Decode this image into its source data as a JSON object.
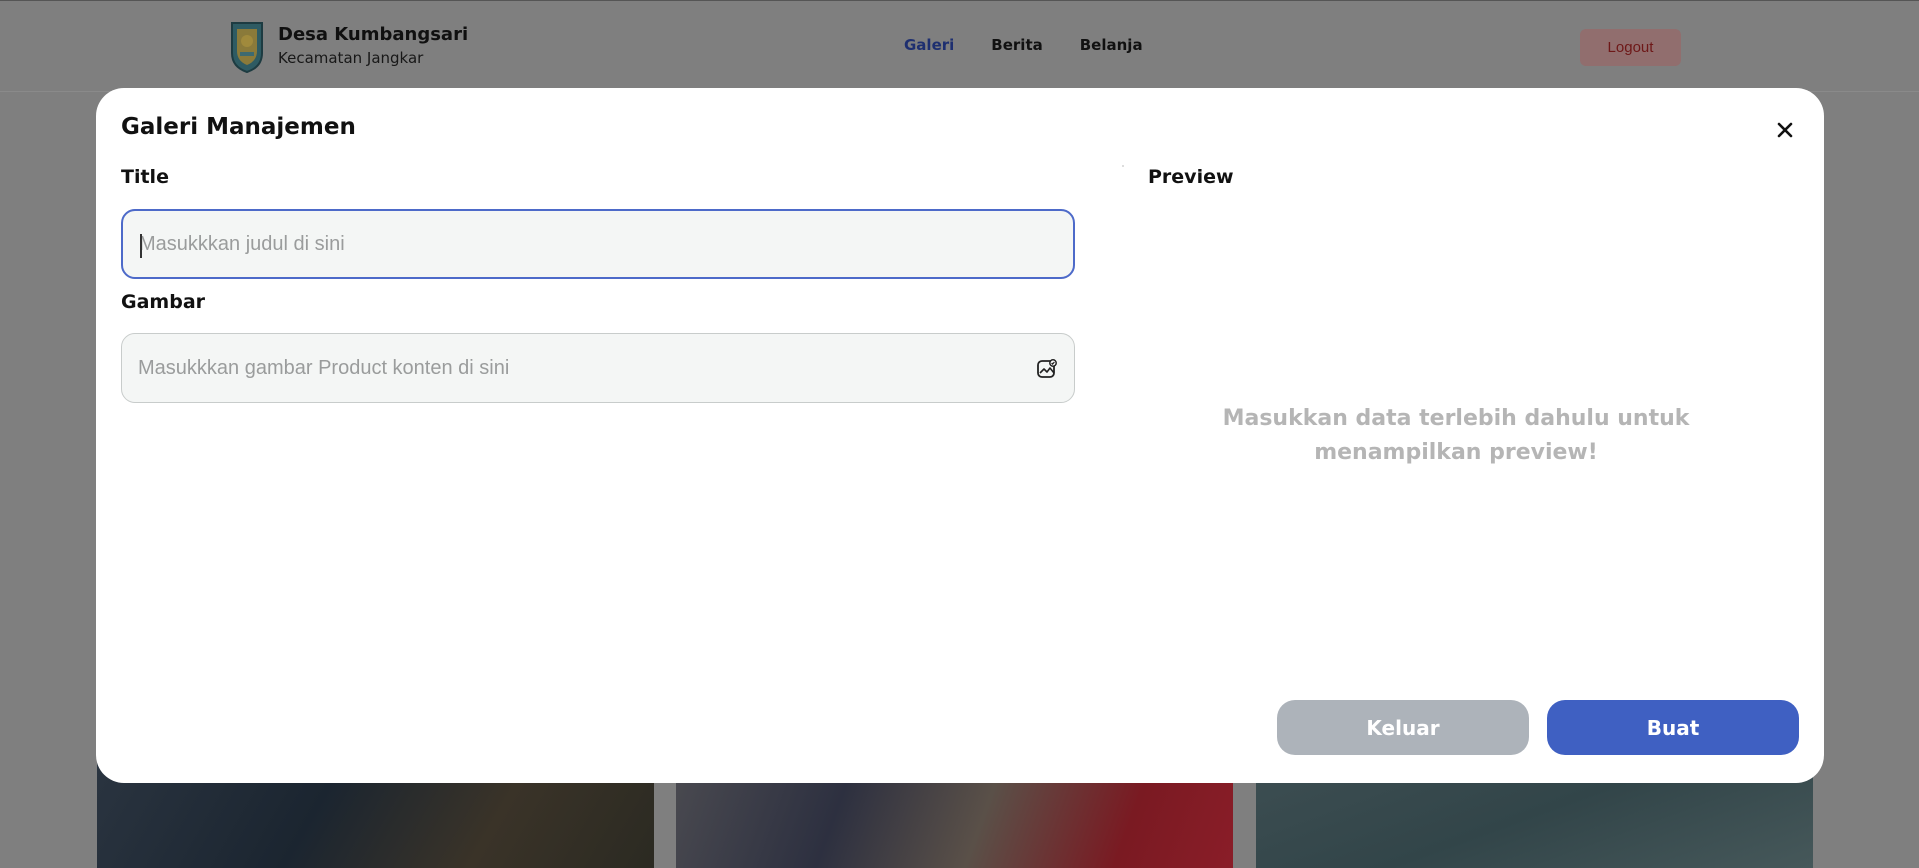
{
  "navbar": {
    "brand_title": "Desa Kumbangsari",
    "brand_subtitle": "Kecamatan Jangkar",
    "links": [
      {
        "label": "Galeri",
        "active": true
      },
      {
        "label": "Berita",
        "active": false
      },
      {
        "label": "Belanja",
        "active": false
      }
    ],
    "logout_label": "Logout"
  },
  "modal": {
    "title": "Galeri Manajemen",
    "close_icon": "close-icon",
    "title_field": {
      "label": "Title",
      "value": "",
      "placeholder": "Masukkkan judul di sini"
    },
    "image_field": {
      "label": "Gambar",
      "value": "",
      "placeholder": "Masukkkan gambar Product konten di sini",
      "icon": "image-upload-icon"
    },
    "preview": {
      "label": "Preview",
      "empty_message": "Masukkan data terlebih dahulu untuk menampilkan preview!"
    },
    "cancel_label": "Keluar",
    "submit_label": "Buat"
  },
  "colors": {
    "primary": "#3f60c2",
    "cancel": "#adb3ba",
    "overlay": "#7f7f7f",
    "empty_text": "#b5b5b5"
  }
}
